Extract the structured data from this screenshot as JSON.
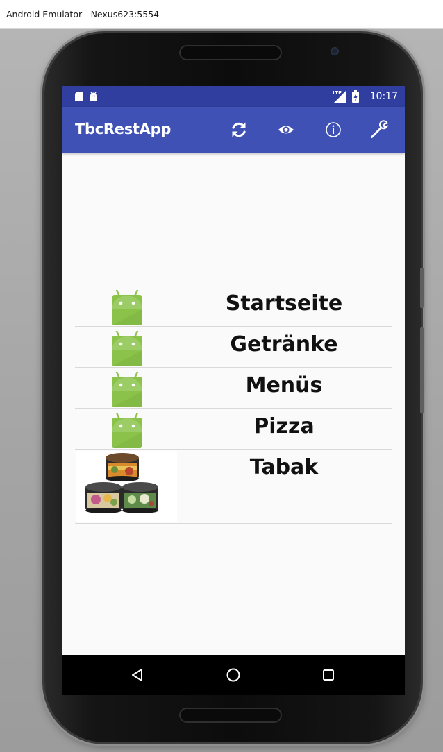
{
  "window": {
    "title": "Android Emulator - Nexus623:5554"
  },
  "status_bar": {
    "time": "10:17",
    "network": "LTE"
  },
  "app_bar": {
    "title": "TbcRestApp",
    "actions": [
      "refresh-icon",
      "eye-icon",
      "info-icon",
      "wrench-icon"
    ]
  },
  "menu": {
    "items": [
      {
        "label": "Startseite",
        "icon": "android-icon"
      },
      {
        "label": "Getränke",
        "icon": "android-icon"
      },
      {
        "label": "Menüs",
        "icon": "android-icon"
      },
      {
        "label": "Pizza",
        "icon": "android-icon"
      },
      {
        "label": "Tabak",
        "icon": "tobacco-tins-image"
      }
    ]
  },
  "nav_bar": {
    "buttons": [
      "back-icon",
      "home-icon",
      "recents-icon"
    ]
  },
  "colors": {
    "status_bar": "#303f9f",
    "app_bar": "#3f51b5",
    "android_green": "#8bc34a",
    "screen_bg": "#fafafa"
  }
}
